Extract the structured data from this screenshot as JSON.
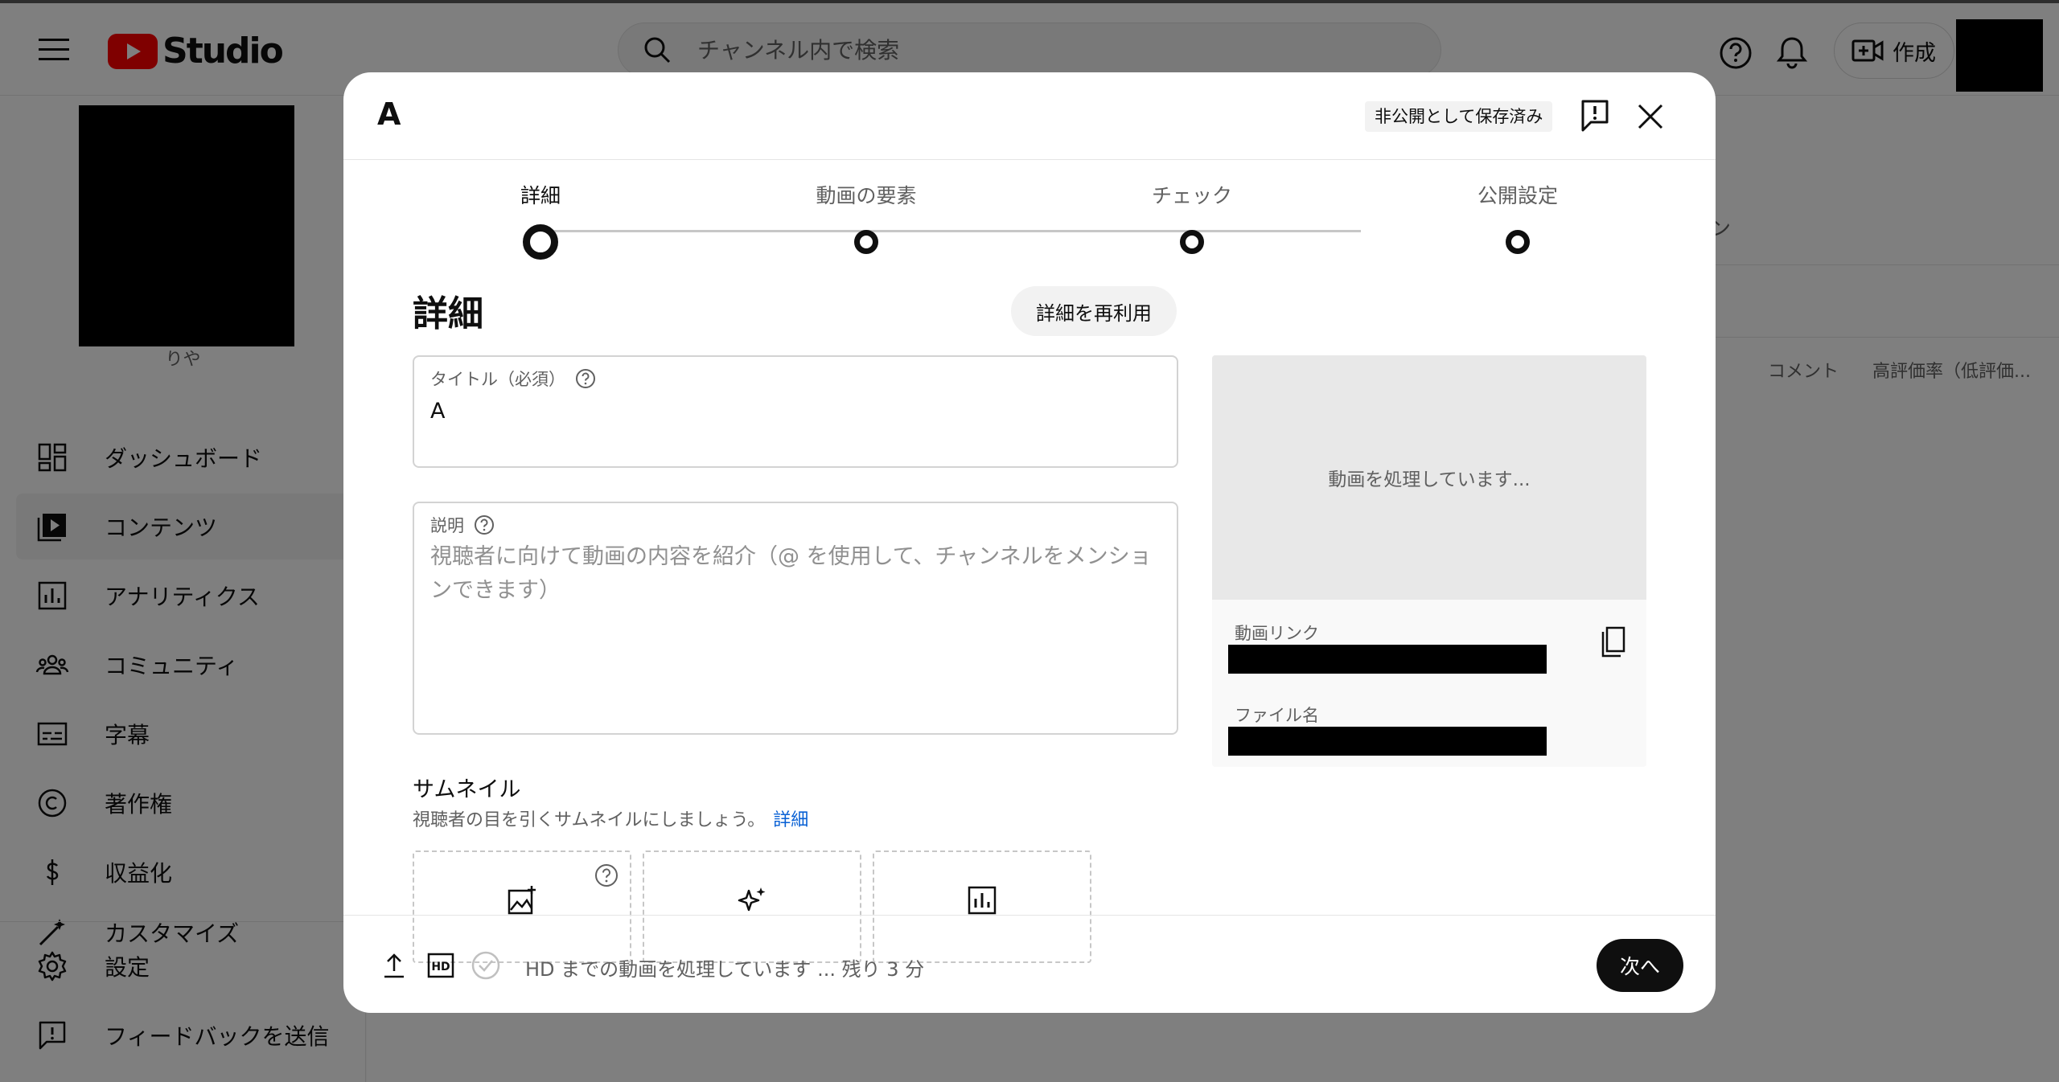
{
  "app": {
    "logo_text": "Studio",
    "search_placeholder": "チャンネル内で検索",
    "create_label": "作成"
  },
  "sidebar": {
    "channel_name": "りや",
    "items": [
      {
        "label": "ダッシュボード",
        "icon": "dashboard-icon"
      },
      {
        "label": "コンテンツ",
        "icon": "content-icon"
      },
      {
        "label": "アナリティクス",
        "icon": "analytics-icon"
      },
      {
        "label": "コミュニティ",
        "icon": "community-icon"
      },
      {
        "label": "字幕",
        "icon": "subtitles-icon"
      },
      {
        "label": "著作権",
        "icon": "copyright-icon"
      },
      {
        "label": "収益化",
        "icon": "monetization-icon"
      },
      {
        "label": "カスタマイズ",
        "icon": "customize-icon"
      }
    ],
    "bottom_items": [
      {
        "label": "設定",
        "icon": "settings-icon"
      },
      {
        "label": "フィードバックを送信",
        "icon": "feedback-icon"
      }
    ]
  },
  "background": {
    "tab_fragment": "ン",
    "columns": [
      "コメント",
      "高評価率（低評価..."
    ]
  },
  "modal": {
    "title": "A",
    "saved_status": "非公開として保存済み",
    "steps": [
      {
        "label": "詳細",
        "active": true
      },
      {
        "label": "動画の要素",
        "active": false
      },
      {
        "label": "チェック",
        "active": false
      },
      {
        "label": "公開設定",
        "active": false
      }
    ],
    "section_heading": "詳細",
    "reuse_button": "詳細を再利用",
    "title_field": {
      "label": "タイトル（必須）",
      "value": "A"
    },
    "description_field": {
      "label": "説明",
      "placeholder": "視聴者に向けて動画の内容を紹介（@ を使用して、チャンネルをメンションできます）"
    },
    "thumbnail": {
      "title": "サムネイル",
      "subtitle": "視聴者の目を引くサムネイルにしましょう。",
      "link": "詳細",
      "options": [
        "upload-thumbnail-icon",
        "auto-generate-icon",
        "test-compare-icon"
      ]
    },
    "preview": {
      "processing_text": "動画を処理しています...",
      "video_link_label": "動画リンク",
      "filename_label": "ファイル名"
    },
    "footer": {
      "status_text": "HD までの動画を処理しています ... 残り 3 分",
      "next_button": "次へ"
    }
  },
  "colors": {
    "accent_red": "#ff0000",
    "link_blue": "#065fd4",
    "primary_dark": "#0f0f0f"
  }
}
